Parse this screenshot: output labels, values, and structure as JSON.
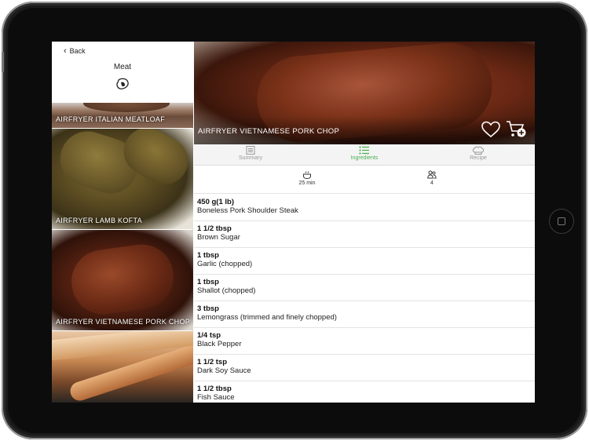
{
  "sidebar": {
    "back_label": "Back",
    "title": "Meat",
    "items": [
      {
        "label": "AIRFRYER ITALIAN MEATLOAF"
      },
      {
        "label": "AIRFRYER LAMB KOFTA"
      },
      {
        "label": "AIRFRYER VIETNAMESE PORK CHOP"
      },
      {
        "label": ""
      }
    ]
  },
  "recipe": {
    "title": "AIRFRYER VIETNAMESE PORK CHOP",
    "tabs": [
      {
        "label": "Summary",
        "icon": "list-icon"
      },
      {
        "label": "Ingredients",
        "icon": "checklist-icon",
        "active": true
      },
      {
        "label": "Recipe",
        "icon": "chef-hat-icon"
      }
    ],
    "time": "25 min",
    "servings": "4",
    "accent_color": "#4caf50",
    "ingredients": [
      {
        "qty": "450 g(1 lb)",
        "name": "Boneless Pork Shoulder Steak"
      },
      {
        "qty": "1 1/2 tbsp",
        "name": "Brown Sugar"
      },
      {
        "qty": "1 tbsp",
        "name": "Garlic (chopped)"
      },
      {
        "qty": "1 tbsp",
        "name": "Shallot (chopped)"
      },
      {
        "qty": "3 tbsp",
        "name": "Lemongrass (trimmed and finely chopped)"
      },
      {
        "qty": "1/4 tsp",
        "name": "Black Pepper"
      },
      {
        "qty": "1 1/2 tsp",
        "name": "Dark Soy Sauce"
      },
      {
        "qty": "1 1/2 tbsp",
        "name": "Fish Sauce"
      }
    ]
  }
}
